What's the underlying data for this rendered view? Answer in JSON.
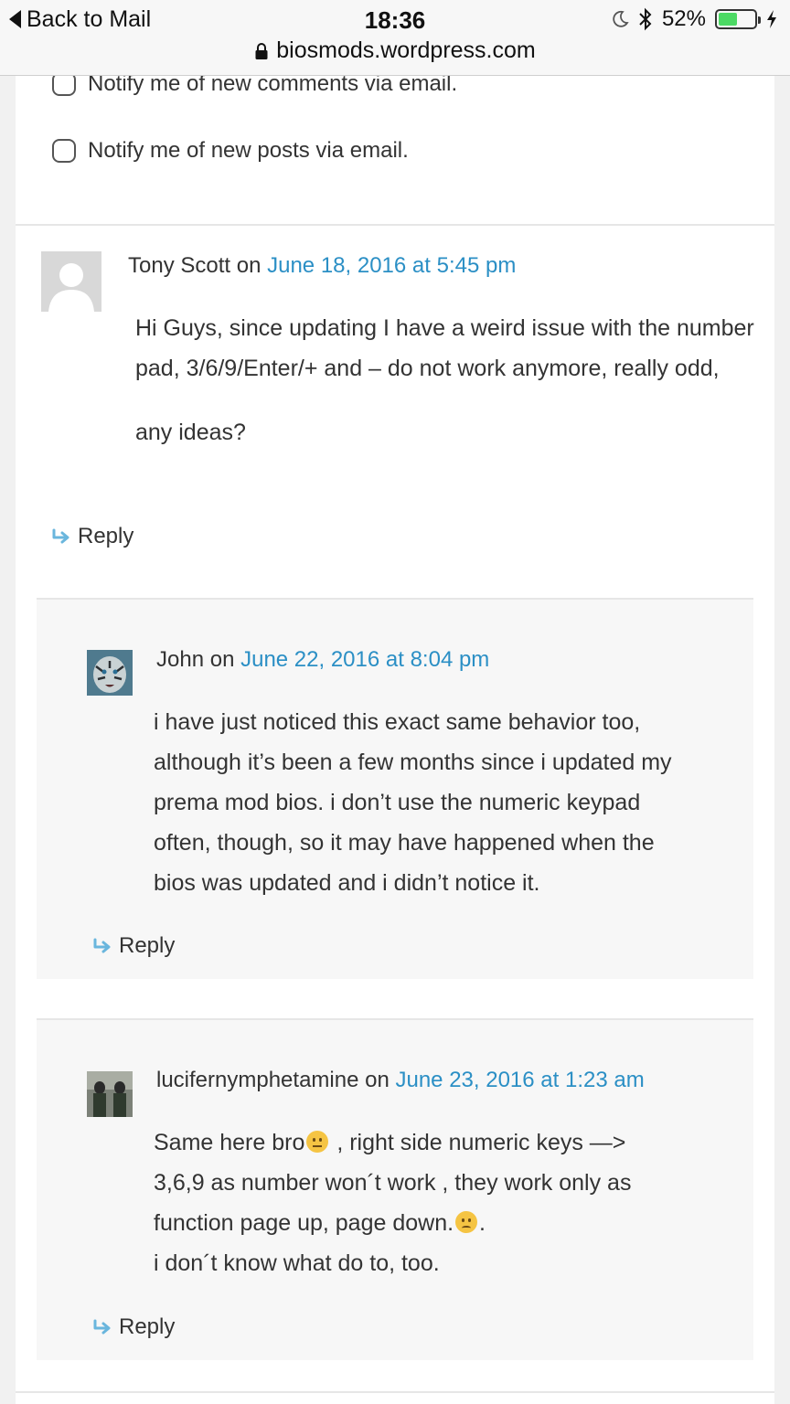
{
  "status_bar": {
    "back_label": "Back to Mail",
    "time": "18:36",
    "battery_percent": "52%",
    "battery_level": 0.52,
    "url": "biosmods.wordpress.com"
  },
  "subscribe": {
    "notify_comments": "Notify me of new comments via email.",
    "notify_posts": "Notify me of new posts via email."
  },
  "comments": [
    {
      "author": "Tony Scott",
      "on": "on",
      "date": "June 18, 2016 at 5:45 pm",
      "paragraphs": [
        "Hi Guys, since updating I have a weird issue with the number pad, 3/6/9/Enter/+ and – do not work anymore, really odd,",
        "any ideas?"
      ],
      "reply_label": "Reply"
    },
    {
      "author": "John",
      "on": "on",
      "date": "June 22, 2016 at 8:04 pm",
      "paragraphs": [
        "i have just noticed this exact same behavior too, although it’s been a few months since i updated my prema mod bios. i don’t use the numeric keypad often, though, so it may have happened when the bios was updated and i didn’t notice it."
      ],
      "reply_label": "Reply"
    },
    {
      "author": "lucifernymphetamine",
      "on": "on",
      "date": "June 23, 2016 at 1:23 am",
      "line1a": "Same here bro",
      "line1b": " , right side numeric keys —>",
      "line2": "3,6,9 as number won´t work , they work only as",
      "line3": "function page up, page down.",
      "line3b": ".",
      "line4": "i don´t know what do to, too.",
      "reply_label": "Reply"
    }
  ],
  "colors": {
    "link": "#2b8fc5",
    "reply_arrow": "#6ab6dd",
    "reply_background": "#f7f7f7"
  }
}
